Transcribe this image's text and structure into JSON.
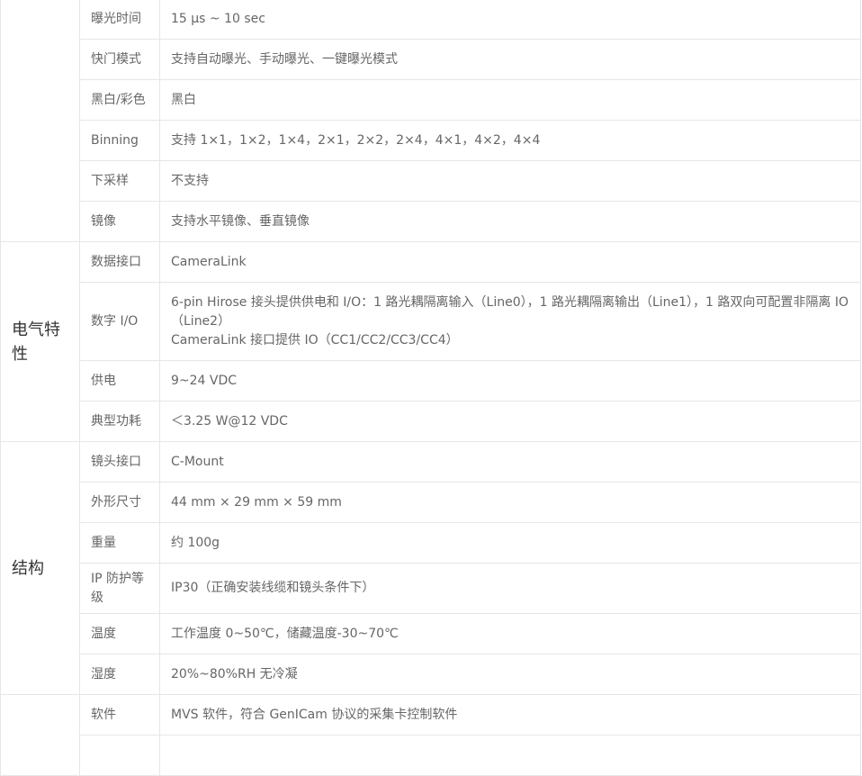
{
  "groups": {
    "electrical": "电气特性",
    "structure": "结构"
  },
  "rows": {
    "exposure_time": {
      "label": "曝光时间",
      "value": "15 μs ~ 10 sec"
    },
    "shutter_mode": {
      "label": "快门模式",
      "value": "支持自动曝光、手动曝光、一键曝光模式"
    },
    "mono_color": {
      "label": "黑白/彩色",
      "value": "黑白"
    },
    "binning": {
      "label": "Binning",
      "value": "支持 1×1，1×2，1×4，2×1，2×2，2×4，4×1，4×2，4×4"
    },
    "decimation": {
      "label": "下采样",
      "value": "不支持"
    },
    "mirror": {
      "label": "镜像",
      "value": "支持水平镜像、垂直镜像"
    },
    "data_interface": {
      "label": "数据接口",
      "value": "CameraLink"
    },
    "digital_io": {
      "label": "数字 I/O",
      "value_line1": "6-pin Hirose 接头提供供电和 I/O：1 路光耦隔离输入（Line0），1 路光耦隔离输出（Line1），1 路双向可配置非隔离 IO（Line2）",
      "value_line2": "CameraLink 接口提供 IO（CC1/CC2/CC3/CC4）"
    },
    "power_supply": {
      "label": "供电",
      "value": "9~24 VDC"
    },
    "power_consumption": {
      "label": "典型功耗",
      "value": "＜3.25 W@12 VDC"
    },
    "lens_mount": {
      "label": "镜头接口",
      "value": "C-Mount"
    },
    "dimensions": {
      "label": "外形尺寸",
      "value": "44 mm × 29 mm × 59 mm"
    },
    "weight": {
      "label": "重量",
      "value": "约 100g"
    },
    "ip_rating": {
      "label": "IP 防护等级",
      "value": "IP30（正确安装线缆和镜头条件下）"
    },
    "temperature": {
      "label": "温度",
      "value": "工作温度 0~50℃，储藏温度-30~70℃"
    },
    "humidity": {
      "label": "湿度",
      "value": "20%~80%RH 无冷凝"
    },
    "software": {
      "label": "软件",
      "value": "MVS 软件，符合 GenICam 协议的采集卡控制软件"
    }
  }
}
